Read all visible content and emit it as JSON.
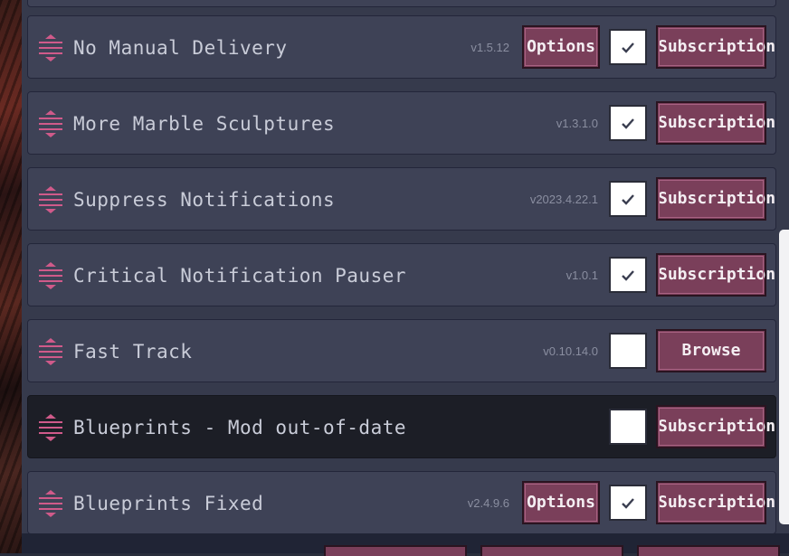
{
  "mods": [
    {
      "name": "",
      "version": "",
      "has_options": false,
      "checked": false,
      "action": ""
    },
    {
      "name": "No Manual Delivery",
      "version": "v1.5.12",
      "has_options": true,
      "options_label": "Options",
      "checked": true,
      "action": "Subscription"
    },
    {
      "name": "More Marble Sculptures",
      "version": "v1.3.1.0",
      "has_options": false,
      "checked": true,
      "action": "Subscription"
    },
    {
      "name": "Suppress Notifications",
      "version": "v2023.4.22.1",
      "has_options": false,
      "checked": true,
      "action": "Subscription"
    },
    {
      "name": "Critical Notification Pauser",
      "version": "v1.0.1",
      "has_options": false,
      "checked": true,
      "action": "Subscription"
    },
    {
      "name": "Fast Track",
      "version": "v0.10.14.0",
      "has_options": false,
      "checked": false,
      "action": "Browse"
    },
    {
      "name": "Blueprints - Mod out-of-date",
      "version": "",
      "has_options": false,
      "checked": false,
      "action": "Subscription",
      "outdated": true
    },
    {
      "name": "Blueprints Fixed",
      "version": "v2.4.9.6",
      "has_options": true,
      "options_label": "Options",
      "checked": true,
      "action": "Subscription"
    }
  ],
  "colors": {
    "accent": "#7a3f5a",
    "handle": "#d05a8a",
    "row_bg": "#3e4256",
    "row_dark_bg": "#1c1e26",
    "text": "#c9ccd8"
  },
  "icons": {
    "drag_handle": "drag-handle-icon",
    "checkmark": "checkmark-icon"
  }
}
